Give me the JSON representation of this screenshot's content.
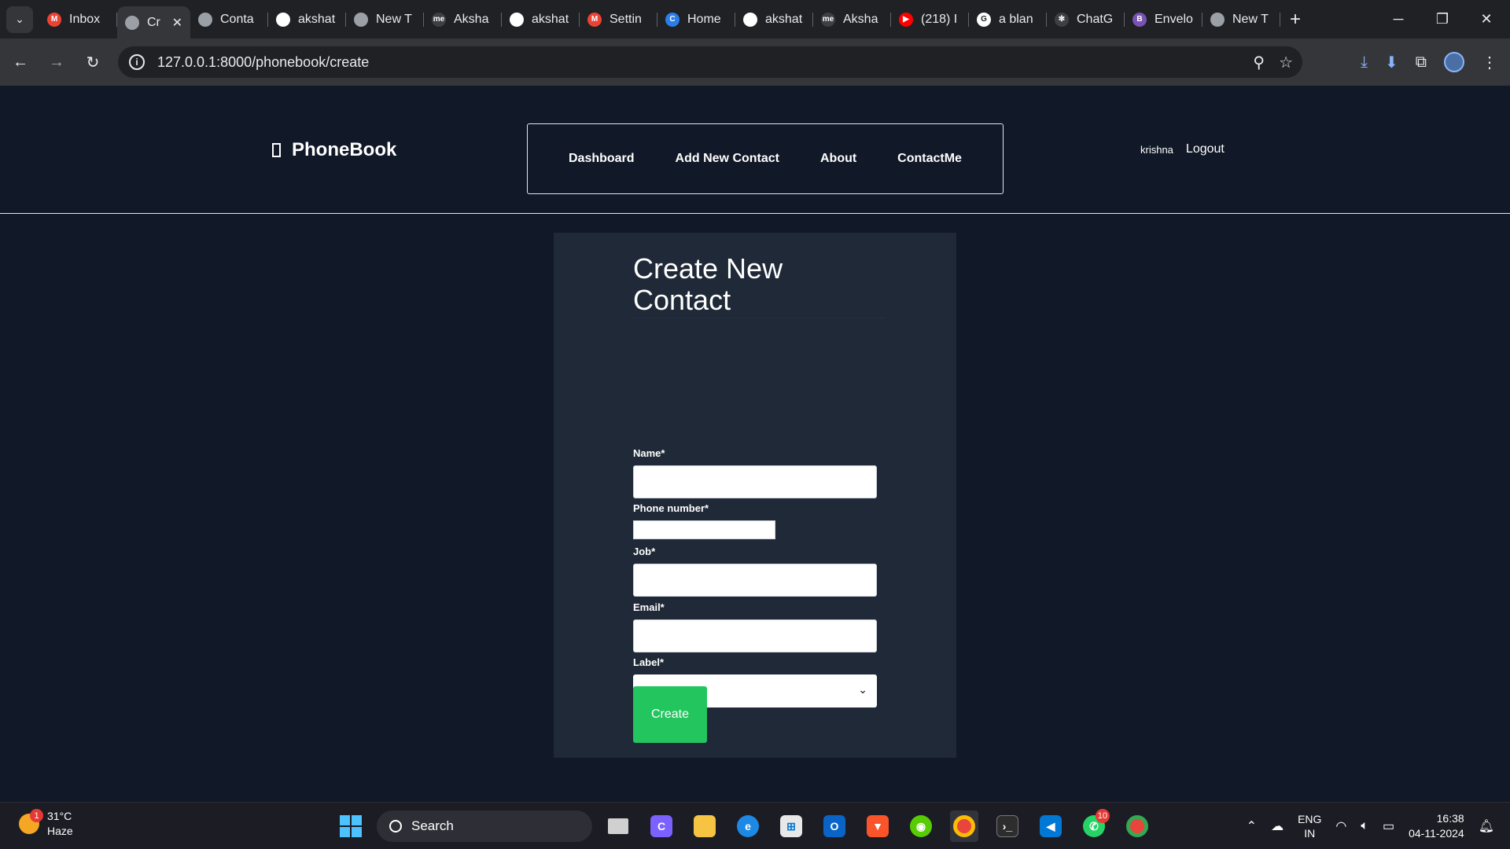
{
  "browser": {
    "tabs": [
      {
        "title": "Inbox",
        "icon": "gmail-icon",
        "color": "#ea4335",
        "glyph": "M"
      },
      {
        "title": "Cr",
        "icon": "globe-icon",
        "color": "#9aa0a6",
        "glyph": "",
        "active": true
      },
      {
        "title": "Conta",
        "icon": "globe-icon",
        "color": "#9aa0a6",
        "glyph": ""
      },
      {
        "title": "akshat",
        "icon": "github-icon",
        "color": "#ffffff",
        "glyph": ""
      },
      {
        "title": "New T",
        "icon": "chrome-icon",
        "color": "#9aa0a6",
        "glyph": ""
      },
      {
        "title": "Aksha",
        "icon": "medium-icon",
        "color": "#3c4043",
        "glyph": "me"
      },
      {
        "title": "akshat",
        "icon": "github-icon",
        "color": "#ffffff",
        "glyph": ""
      },
      {
        "title": "Settin",
        "icon": "gmail-icon",
        "color": "#ea4335",
        "glyph": "M"
      },
      {
        "title": "Home",
        "icon": "copilot-icon",
        "color": "#2b7de9",
        "glyph": "C"
      },
      {
        "title": "akshat",
        "icon": "github-icon",
        "color": "#ffffff",
        "glyph": ""
      },
      {
        "title": "Aksha",
        "icon": "medium-icon",
        "color": "#3c4043",
        "glyph": "me"
      },
      {
        "title": "(218) I",
        "icon": "youtube-icon",
        "color": "#ff0000",
        "glyph": "▶"
      },
      {
        "title": "a blan",
        "icon": "google-icon",
        "color": "#ffffff",
        "glyph": "G"
      },
      {
        "title": "ChatG",
        "icon": "chatgpt-icon",
        "color": "#3c4043",
        "glyph": "✻"
      },
      {
        "title": "Envelo",
        "icon": "bootstrap-icon",
        "color": "#7952b3",
        "glyph": "B"
      },
      {
        "title": "New T",
        "icon": "chrome-icon",
        "color": "#9aa0a6",
        "glyph": ""
      }
    ],
    "url": "127.0.0.1:8000/phonebook/create"
  },
  "site": {
    "brand": "PhoneBook",
    "nav": [
      "Dashboard",
      "Add New Contact",
      "About",
      "ContactMe"
    ],
    "username": "krishna",
    "logout": "Logout"
  },
  "form": {
    "title": "Create New Contact",
    "fields": {
      "name": {
        "label": "Name*",
        "value": ""
      },
      "phone": {
        "label": "Phone number*",
        "value": ""
      },
      "job": {
        "label": "Job*",
        "value": ""
      },
      "email": {
        "label": "Email*",
        "value": ""
      },
      "label": {
        "label": "Label*",
        "selected": "---------"
      }
    },
    "submit": "Create",
    "submit_color": "#22c55e"
  },
  "taskbar": {
    "weather_temp": "31°C",
    "weather_desc": "Haze",
    "weather_badge": "1",
    "search": "Search",
    "whatsapp_badge": "10",
    "lang": "ENG",
    "region": "IN",
    "time": "16:38",
    "date": "04-11-2024"
  }
}
